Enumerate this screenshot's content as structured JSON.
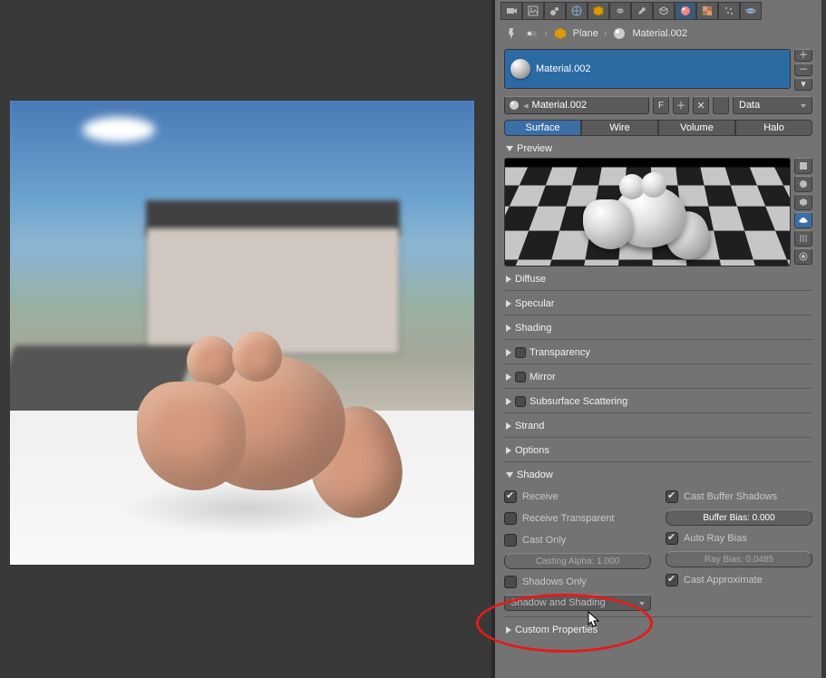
{
  "breadcrumb": {
    "object": "Plane",
    "material": "Material.002"
  },
  "slot": {
    "name": "Material.002"
  },
  "id_block": {
    "name": "Material.002",
    "fake_user": "F",
    "link_select": "Data"
  },
  "material_type": {
    "t1": "Surface",
    "t2": "Wire",
    "t3": "Volume",
    "t4": "Halo"
  },
  "panels": {
    "preview": "Preview",
    "diffuse": "Diffuse",
    "specular": "Specular",
    "shading": "Shading",
    "transparency": "Transparency",
    "mirror": "Mirror",
    "sss": "Subsurface Scattering",
    "strand": "Strand",
    "options": "Options",
    "shadow": "Shadow",
    "custom": "Custom Properties"
  },
  "shadow": {
    "receive": "Receive",
    "receive_transparent": "Receive Transparent",
    "cast_only": "Cast Only",
    "casting_alpha": "Casting Alpha: 1.000",
    "shadows_only": "Shadows Only",
    "shadows_only_type": "Shadow and Shading",
    "cast_buffer": "Cast Buffer Shadows",
    "buffer_bias": "Buffer Bias: 0.000",
    "auto_ray_bias": "Auto Ray Bias",
    "ray_bias": "Ray Bias: 0.0485",
    "cast_approx": "Cast Approximate"
  }
}
